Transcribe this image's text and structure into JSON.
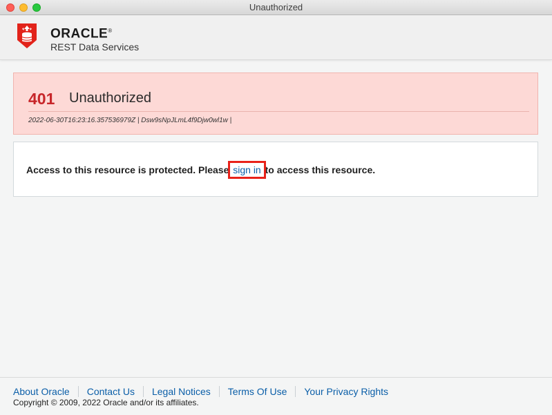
{
  "window": {
    "title": "Unauthorized"
  },
  "header": {
    "brand_name": "ORACLE",
    "brand_reg": "®",
    "product_name": "REST Data Services",
    "logo_icon": "oracle-rest-data-services-logo-icon",
    "brand_color": "#e2231a"
  },
  "error": {
    "code": "401",
    "title": "Unauthorized",
    "meta": "2022-06-30T16:23:16.357536979Z | Dsw9sNpJLmL4f9Djw0wl1w |",
    "accent_color": "#c7262a",
    "background_color": "#fdd9d6"
  },
  "message": {
    "prefix": "Access to this resource is protected. Please ",
    "link_label": "sign in",
    "suffix": " to access this resource.",
    "link_color": "#0a5ea8",
    "highlight_color": "#e8221a"
  },
  "footer": {
    "links": [
      "About Oracle",
      "Contact Us",
      "Legal Notices",
      "Terms Of Use",
      "Your Privacy Rights"
    ],
    "copyright": "Copyright © 2009, 2022 Oracle and/or its affiliates."
  }
}
